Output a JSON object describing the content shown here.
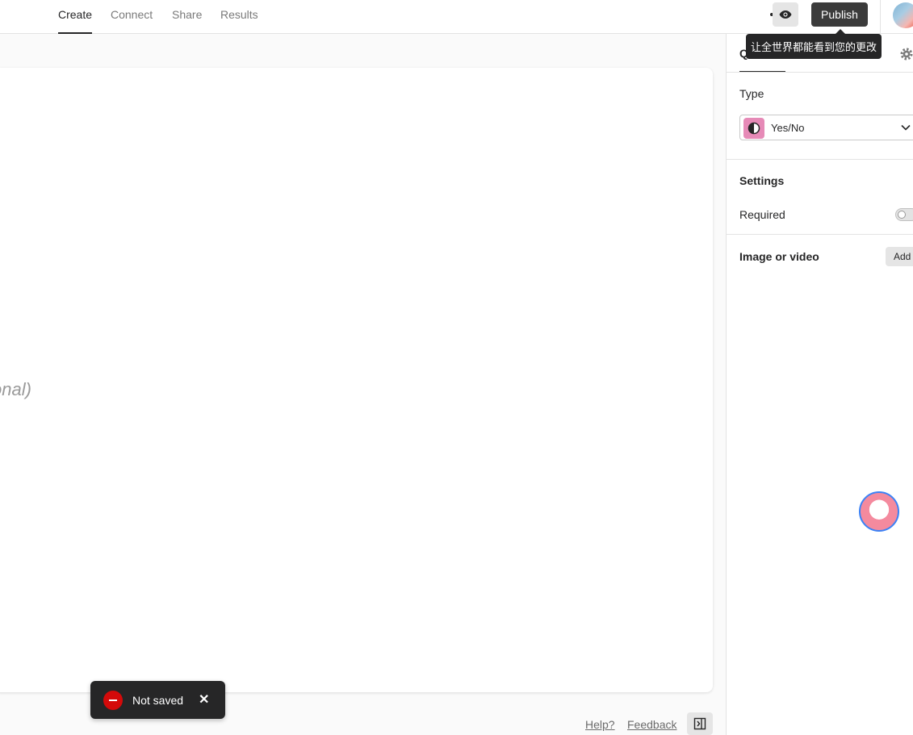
{
  "nav": {
    "tabs": [
      {
        "label": "Create"
      },
      {
        "label": "Connect"
      },
      {
        "label": "Share"
      },
      {
        "label": "Results"
      }
    ],
    "active_tab": "Create",
    "publish_label": "Publish"
  },
  "tooltip": {
    "text": "让全世界都能看到您的更改"
  },
  "canvas": {
    "description_fragment": "onal)"
  },
  "panel": {
    "tab_label": "Q",
    "type_label": "Type",
    "type_value": "Yes/No",
    "settings_label": "Settings",
    "required_label": "Required",
    "required_on": false,
    "media_label": "Image or video",
    "add_label": "Add"
  },
  "toast": {
    "text": "Not saved"
  },
  "footer": {
    "help": "Help?",
    "feedback": "Feedback"
  },
  "colors": {
    "accent_dark": "#262627",
    "type_icon_bg": "#e68ab7",
    "error_red": "#d40a0a",
    "chat_border": "#3b82f6"
  },
  "icons": [
    "eye-icon",
    "gear-icon",
    "chevron-down-icon",
    "yes-no-icon",
    "minus-icon",
    "close-icon",
    "panel-collapse-icon"
  ]
}
